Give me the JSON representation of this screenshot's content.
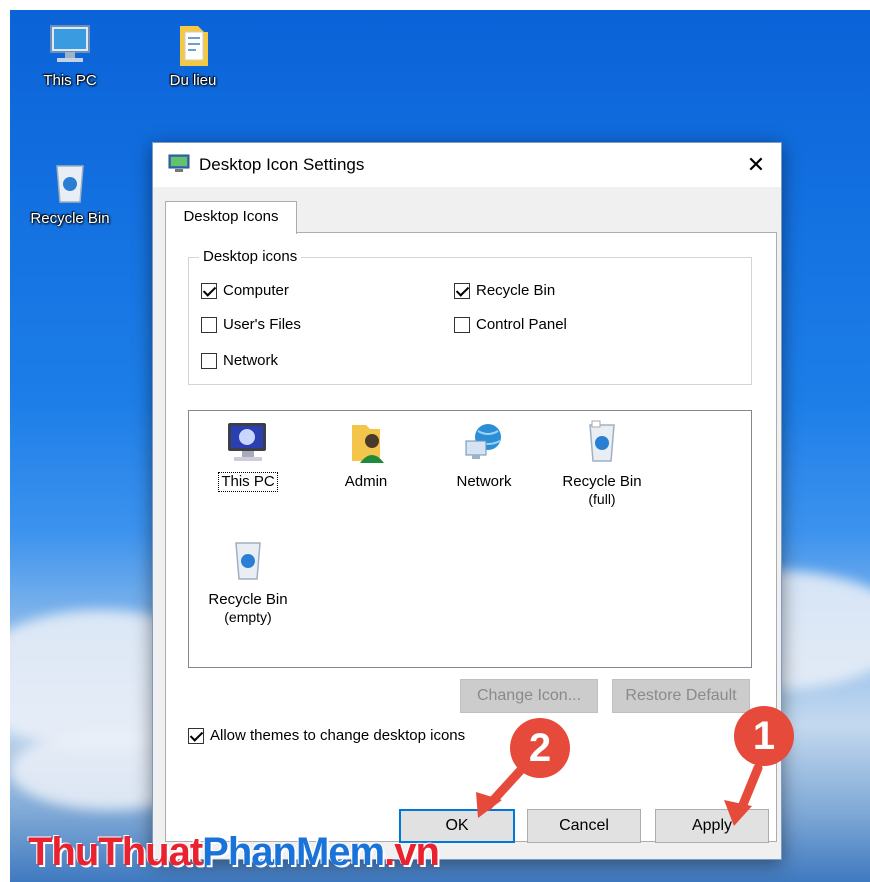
{
  "desktop": {
    "icons": [
      {
        "label": "This PC",
        "icon": "monitor-icon"
      },
      {
        "label": "Du lieu",
        "icon": "folder-icon"
      },
      {
        "label": "Recycle Bin",
        "icon": "recycle-bin-icon"
      }
    ]
  },
  "dialog": {
    "title": "Desktop Icon Settings",
    "close_symbol": "✕",
    "tab": "Desktop Icons",
    "group_title": "Desktop icons",
    "checkboxes": [
      {
        "label": "Computer",
        "checked": true
      },
      {
        "label": "Recycle Bin",
        "checked": true
      },
      {
        "label": "User's Files",
        "checked": false
      },
      {
        "label": "Control Panel",
        "checked": false
      },
      {
        "label": "Network",
        "checked": false
      }
    ],
    "icon_items": [
      {
        "label": "This PC",
        "sub": ""
      },
      {
        "label": "Admin",
        "sub": ""
      },
      {
        "label": "Network",
        "sub": ""
      },
      {
        "label": "Recycle Bin",
        "sub": "(full)"
      },
      {
        "label": "Recycle Bin",
        "sub": "(empty)"
      }
    ],
    "change_icon_label": "Change Icon...",
    "restore_default_label": "Restore Default",
    "allow_themes": {
      "label": "Allow themes to change desktop icons",
      "checked": true
    },
    "ok_label": "OK",
    "cancel_label": "Cancel",
    "apply_label": "Apply"
  },
  "annotations": {
    "marker1": "1",
    "marker2": "2",
    "color": "#e64a3b"
  },
  "watermark": {
    "part1": "ThuThuat",
    "part2": "PhanMem",
    "part3": ".vn"
  }
}
